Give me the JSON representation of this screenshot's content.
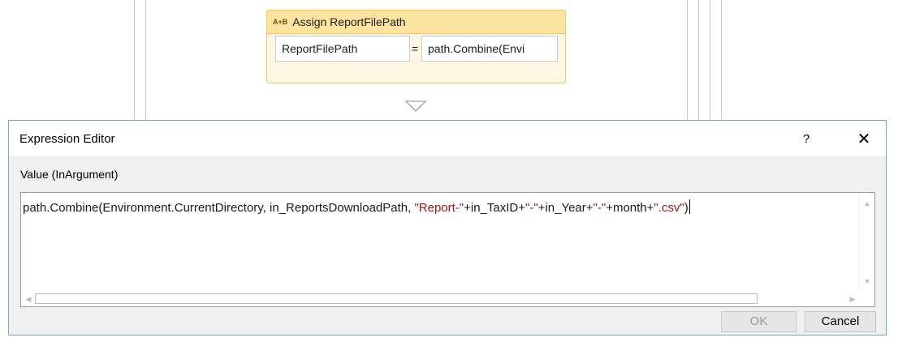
{
  "designer": {
    "activity_icon": "A+B",
    "activity_title": "Assign ReportFilePath",
    "to_field": "ReportFilePath",
    "equals": "=",
    "value_field": "path.Combine(Envi"
  },
  "dialog": {
    "title": "Expression Editor",
    "help_label": "?",
    "close_label": "✕",
    "value_label": "Value (InArgument)",
    "code": {
      "p1": "path.Combine(Environment.CurrentDirectory, in_ReportsDownloadPath, ",
      "s1": "\"Report-\"",
      "p2": "+in_TaxID+",
      "s2": "\"-\"",
      "p3": "+in_Year+",
      "s3": "\"-\"",
      "p4": "+month+",
      "s4": "\".csv\"",
      "p5": ")"
    },
    "ok_label": "OK",
    "cancel_label": "Cancel"
  },
  "colors": {
    "string_literal": "#a31515",
    "assign_header": "#fbe3a0",
    "assign_border": "#f0c85a"
  }
}
